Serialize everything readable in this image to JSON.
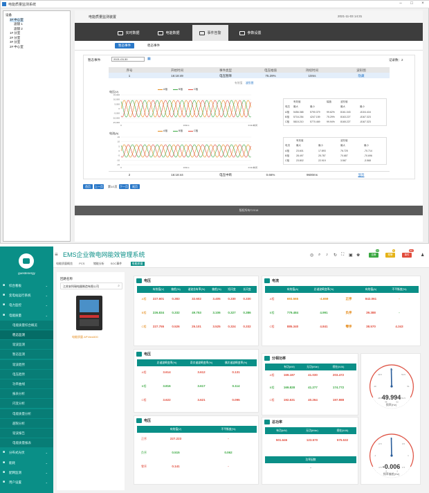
{
  "window": {
    "title": "电能质量监测系统"
  },
  "tree": {
    "items": [
      {
        "label": "设备",
        "level": 0
      },
      {
        "label": "3# 中心室",
        "level": 1,
        "selected": true
      },
      {
        "label": "滤镜 1",
        "level": 2
      },
      {
        "label": "滤镜 2",
        "level": 2
      },
      {
        "label": "1# 分室",
        "level": 1
      },
      {
        "label": "2# 分室",
        "level": 1
      },
      {
        "label": "3# 分室",
        "level": 1
      },
      {
        "label": "2# 中心室",
        "level": 1
      }
    ]
  },
  "top": {
    "heading": "电能质量监测装置",
    "datetime": "2021-11-03 14:31",
    "nav": [
      {
        "label": "实时数据",
        "active": false
      },
      {
        "label": "电能数据",
        "active": false
      },
      {
        "label": "事件告警",
        "active": true
      },
      {
        "label": "参数设置",
        "active": false
      }
    ],
    "subtabs": [
      {
        "label": "暂态事件",
        "active": true
      },
      {
        "label": "稳态事件",
        "active": false
      }
    ],
    "filter": {
      "label": "暂态事件:",
      "date": "2021-03-30"
    },
    "total": "记录数：2",
    "columns": [
      "序号",
      "开始时间",
      "事件类型",
      "电压幅值",
      "持续时间",
      "波形图"
    ],
    "rows": [
      {
        "no": "1",
        "time": "16:18:49",
        "type": "电压暂降",
        "amp": "75.29%",
        "dur": "10ms",
        "link": "隐藏"
      },
      {
        "no": "2",
        "time": "16:18:44",
        "type": "电压中断",
        "amp": "0.66%",
        "dur": "9600ms",
        "link": "显示"
      }
    ],
    "wave_tabs": [
      "有效值",
      "波形图"
    ],
    "voltage_chart": {
      "ylabel": "电压(V)",
      "legend": [
        "A相",
        "B相",
        "C相"
      ],
      "yticks": [
        "15,000",
        "10,000",
        "5,000",
        "0",
        "-5,000",
        "-10,000",
        "-15,000"
      ],
      "xticks": [
        "0",
        "100ms",
        "210ms"
      ],
      "xaxis": "时间"
    },
    "current_chart": {
      "ylabel": "电流(A)",
      "legend": [
        "A相",
        "B相",
        "C相"
      ],
      "yticks": [
        "15",
        "10",
        "5",
        "0",
        "-5",
        "-10",
        "-15"
      ],
      "xticks": [
        "0",
        "100ms",
        "210ms"
      ],
      "xaxis": "时间"
    },
    "vtable": {
      "head1": [
        "",
        "有效值",
        "",
        "幅值",
        "波形值",
        ""
      ],
      "head2": [
        "电压",
        "最大",
        "最小",
        "",
        "最大",
        "最小"
      ],
      "rows": [
        [
          "A相",
          "5456.368",
          "5790.379",
          "99.62%",
          "8161.043",
          "-8104.416"
        ],
        [
          "B相",
          "5716.254",
          "4247.159",
          "75.29%",
          "8163.227",
          "-8167.323"
        ],
        [
          "C相",
          "5815.210",
          "5770.469",
          "99.94%",
          "8165.227",
          "-8167.323"
        ]
      ]
    },
    "itable": {
      "head1": [
        "",
        "有效值",
        "",
        "波形值",
        ""
      ],
      "head2": [
        "电流",
        "最大",
        "最小",
        "最大",
        "最小"
      ],
      "rows": [
        [
          "A相",
          "23.601",
          "17.893",
          "76.725",
          "-70.714"
        ],
        [
          "B相",
          "28.497",
          "25.787",
          "70.687",
          "-70.696"
        ],
        [
          "C相",
          "23.802",
          "22.919",
          "3.567",
          "-3.568"
        ]
      ]
    },
    "pager": [
      "首页",
      "上一页",
      "第1/1页",
      "下一页",
      "尾页"
    ],
    "footer": "版权所有©2018"
  },
  "ems": {
    "title": "EMS企业微电网能效管理系统",
    "user": "guestenergy",
    "badges": [
      {
        "label": "告警",
        "count": "12",
        "color": "#3aa841"
      },
      {
        "label": "预警",
        "count": "9",
        "color": "#e5b318"
      },
      {
        "label": "事件",
        "count": "99+",
        "color": "#e14b3b"
      }
    ],
    "crumbs": [
      "电能质量概览",
      "PCS",
      "储能分析",
      "SOC事件",
      "电能质量"
    ],
    "menu": [
      {
        "label": "综合看板",
        "sub": false,
        "active": false
      },
      {
        "label": "变电站运行系统",
        "sub": false,
        "active": false
      },
      {
        "label": "电力监控",
        "sub": false,
        "active": false
      },
      {
        "label": "电能质量",
        "sub": false,
        "active": false
      },
      {
        "label": "电能质量综合概览",
        "sub": true,
        "active": false
      },
      {
        "label": "稳态监测",
        "sub": true,
        "active": true
      },
      {
        "label": "谐波监测",
        "sub": true,
        "active": false
      },
      {
        "label": "暂态监测",
        "sub": true,
        "active": false
      },
      {
        "label": "谐波趋势",
        "sub": true,
        "active": false
      },
      {
        "label": "电压趋势",
        "sub": true,
        "active": false
      },
      {
        "label": "功率曲线",
        "sub": true,
        "active": false
      },
      {
        "label": "报表分析",
        "sub": true,
        "active": false
      },
      {
        "label": "闪变分析",
        "sub": true,
        "active": false
      },
      {
        "label": "电能质量分析",
        "sub": true,
        "active": false
      },
      {
        "label": "越限分析",
        "sub": true,
        "active": false
      },
      {
        "label": "谐波报告",
        "sub": true,
        "active": false
      },
      {
        "label": "电能质量报表",
        "sub": true,
        "active": false
      },
      {
        "label": "分布式光伏",
        "sub": false,
        "active": false
      },
      {
        "label": "能耗",
        "sub": false,
        "active": false
      },
      {
        "label": "配网监测",
        "sub": false,
        "active": false
      },
      {
        "label": "用户设置",
        "sub": false,
        "active": false
      }
    ],
    "device": {
      "label": "回路名称",
      "name": "江苏安科瑞电器制造有限公司",
      "model": "电能质量 APView500"
    },
    "voltage": {
      "title": "电压",
      "cols": [
        "有效值(V)",
        "偏差(%)",
        "谐波含有率(%)",
        "偏差(%)",
        "短闪变",
        "长闪变"
      ],
      "rows": [
        [
          "A相",
          "227.601",
          "0.383",
          "32.602",
          "3.405",
          "0.330",
          "0.330"
        ],
        [
          "B相",
          "226.834",
          "0.332",
          "49.753",
          "3.106",
          "0.327",
          "0.386"
        ],
        [
          "C相",
          "227.755",
          "0.526",
          "25.101",
          "3.525",
          "0.324",
          "0.332"
        ]
      ]
    },
    "current": {
      "title": "电流",
      "cols": [
        "有效值(A)",
        "总谐波畸变率(%)",
        "",
        "有效值(A)",
        "不平衡度(%)"
      ],
      "rows": [
        [
          "A相",
          "693.565",
          "-4.659",
          "正序",
          "842.061",
          "-"
        ],
        [
          "B相",
          "779.484",
          "4.991",
          "负序",
          "39.388",
          "-"
        ],
        [
          "C相",
          "885.340",
          "4.841",
          "零序",
          "38.570",
          "4.343"
        ]
      ]
    },
    "voltage2": {
      "title": "电压",
      "cols": [
        "总谐波畸变率(%)",
        "奇次谐波畸变率(%)",
        "偶次谐波畸变率(%)"
      ],
      "rows": [
        [
          "A相",
          "3.614",
          "3.612",
          "0.131"
        ],
        [
          "B相",
          "3.816",
          "3.617",
          "0.114"
        ],
        [
          "C相",
          "3.622",
          "3.621",
          "0.095"
        ]
      ]
    },
    "voltage3": {
      "title": "电压",
      "cols": [
        "有效值(V)",
        "不平衡度(%)"
      ],
      "rows": [
        [
          "正序",
          "227.223",
          "-"
        ],
        [
          "负序",
          "0.515",
          "0.062"
        ],
        [
          "零序",
          "0.141",
          "-"
        ]
      ]
    },
    "phase_power": {
      "title": "分相功率",
      "cols": [
        "有功(kW)",
        "无功(kVar)",
        "视在(kVA)"
      ],
      "rows": [
        [
          "A相",
          "169.187",
          "41.030",
          "203.472"
        ],
        [
          "B相",
          "169.828",
          "41.277",
          "174.772"
        ],
        [
          "C相",
          "192.631",
          "40.264",
          "197.988"
        ]
      ]
    },
    "total_power": {
      "title": "总功率",
      "cols": [
        "有功(kW)",
        "无功(kVar)",
        "视在(kVA)"
      ],
      "values": [
        "501.646",
        "123.570",
        "575.532"
      ],
      "pf_label": "功率因数",
      "pf_value": "-"
    },
    "freq_gauge": {
      "value": "49.994",
      "label": "频率(Hz)",
      "ticks": [
        "48.5",
        "49",
        "49.5",
        "50",
        "50.5",
        "51",
        "51.5",
        "48",
        "52"
      ]
    },
    "dev_gauge": {
      "value": "-0.006",
      "label": "频率偏差(Hz)",
      "ticks": [
        "-1.5",
        "-1",
        "-0.5",
        "0",
        "0.5",
        "1",
        "1.5",
        "-2",
        "2"
      ]
    }
  }
}
